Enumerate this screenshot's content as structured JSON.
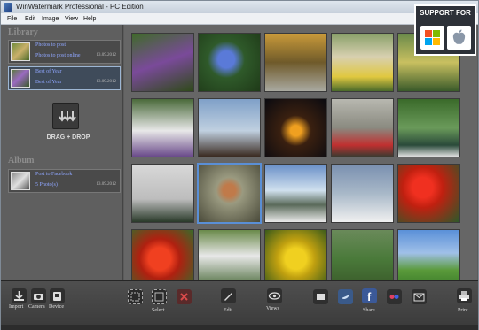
{
  "window": {
    "title": "WinWatermark Professional - PC Edition"
  },
  "menu": [
    "File",
    "Edit",
    "Image",
    "View",
    "Help"
  ],
  "badge": {
    "text": "SUPPORT FOR",
    "platforms": [
      "windows-logo",
      "apple-logo"
    ]
  },
  "sidebar": {
    "library_title": "Library",
    "library_items": [
      {
        "name": "Photos to post",
        "sub": "Photos to post online",
        "date": "13.09.2012"
      },
      {
        "name": "Best of Year",
        "sub": "Best of Year",
        "date": "13.09.2012"
      }
    ],
    "drag_label": "DRAG + DROP",
    "album_title": "Album",
    "album_items": [
      {
        "name": "Post to Facebook",
        "sub": "5 Photo(s)",
        "date": "13.09.2012"
      }
    ]
  },
  "toolbar": {
    "import": "Import",
    "camera": "Camera",
    "device": "Device",
    "select": "Select",
    "edit": "Edit",
    "views": "Views",
    "share": "Share",
    "print": "Print"
  },
  "colors": {
    "accent": "#5a8fd6",
    "link": "#8fa6ff",
    "delete": "#d84a4a"
  }
}
